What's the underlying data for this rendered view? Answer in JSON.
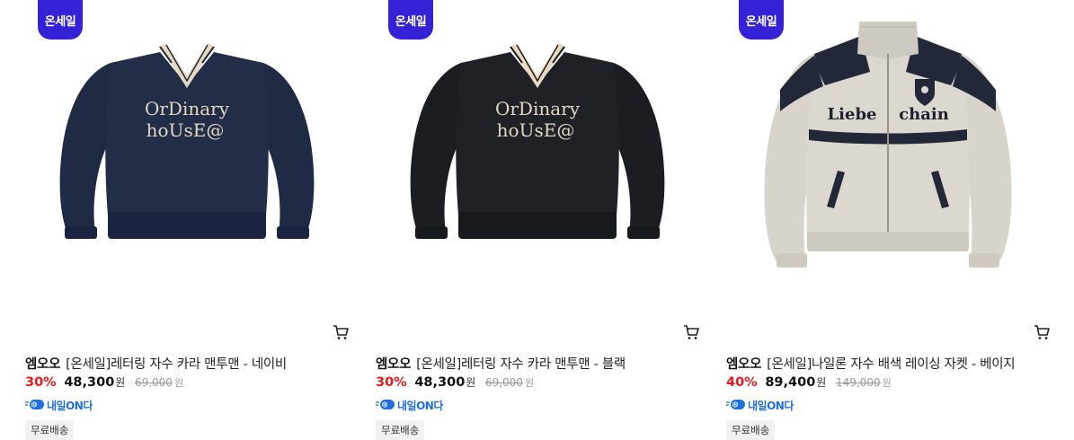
{
  "products": [
    {
      "badge": "온세일",
      "brand": "엠오오",
      "name": "[온세일]레터링 자수 카라 맨투맨 - 네이비",
      "discount": "30%",
      "price": "48,300",
      "price_unit": "원",
      "original_price": "69,000",
      "original_unit": "원",
      "delivery_label": "내일ON다",
      "shipping": "무료배송",
      "image_text": [
        "OrDinary",
        "hoUsE@"
      ],
      "body_color": "#1f2a44",
      "collar_color": "#e8d9c0"
    },
    {
      "badge": "온세일",
      "brand": "엠오오",
      "name": "[온세일]레터링 자수 카라 맨투맨 - 블랙",
      "discount": "30%",
      "price": "48,300",
      "price_unit": "원",
      "original_price": "69,000",
      "original_unit": "원",
      "delivery_label": "내일ON다",
      "shipping": "무료배송",
      "image_text": [
        "OrDinary",
        "hoUsE@"
      ],
      "body_color": "#1c1d22",
      "collar_color": "#e8d9c0"
    },
    {
      "badge": "온세일",
      "brand": "엠오오",
      "name": "[온세일]나일론 자수 배색 레이싱 자켓 - 베이지",
      "discount": "40%",
      "price": "89,400",
      "price_unit": "원",
      "original_price": "149,000",
      "original_unit": "원",
      "delivery_label": "내일ON다",
      "shipping": "무료배송",
      "image_text": [
        "Liebe",
        "chain"
      ],
      "body_color": "#d8d4cc",
      "panel_color": "#232838"
    }
  ],
  "colors": {
    "badge_bg": "#3522d6",
    "discount": "#e11b1b",
    "delivery": "#1e6fe0"
  }
}
